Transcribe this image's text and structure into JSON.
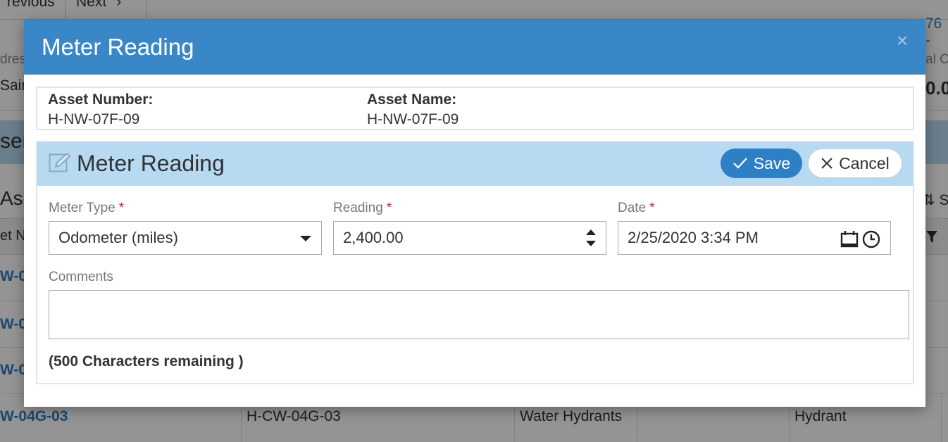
{
  "background": {
    "pager_prev": "revious",
    "pager_next": "Next",
    "record_count": "76 -",
    "address_label": "dres",
    "address_value": "Sain",
    "total_label": "al Co",
    "total_value": "0.0",
    "band_text": "ser",
    "grid_title": "As",
    "sort_label": "So",
    "column_header": "et N",
    "rows": [
      {
        "asset_number": "W-0",
        "asset_name": "",
        "type": "",
        "class": ""
      },
      {
        "asset_number": "W-0",
        "asset_name": "",
        "type": "",
        "class": ""
      },
      {
        "asset_number": "W-0",
        "asset_name": "",
        "type": "",
        "class": ""
      },
      {
        "asset_number": "W-04G-03",
        "asset_name": "H-CW-04G-03",
        "type": "Water Hydrants",
        "class": "Hydrant"
      }
    ]
  },
  "modal": {
    "title": "Meter Reading",
    "close_symbol": "×",
    "asset": {
      "number_label": "Asset Number:",
      "number_value": "H-NW-07F-09",
      "name_label": "Asset Name:",
      "name_value": "H-NW-07F-09"
    },
    "form": {
      "title": "Meter Reading",
      "save_label": "Save",
      "cancel_label": "Cancel",
      "meter_type": {
        "label": "Meter Type",
        "required": "*",
        "value": "Odometer (miles)"
      },
      "reading": {
        "label": "Reading",
        "required": "*",
        "value": "2,400.00"
      },
      "date": {
        "label": "Date",
        "required": "*",
        "value": "2/25/2020 3:34 PM"
      },
      "comments": {
        "label": "Comments",
        "value": ""
      },
      "chars_remaining": "(500 Characters remaining )"
    }
  },
  "colors": {
    "header_blue": "#3a87c8",
    "panel_blue": "#b7d9f2",
    "save_blue": "#2f7fc4",
    "required_red": "#d9262c",
    "link_blue": "#2d7cc0"
  },
  "icons": [
    "close-icon",
    "edit-icon",
    "checkmark-icon",
    "x-icon",
    "dropdown-arrow-icon",
    "spinner-icon",
    "calendar-icon",
    "clock-icon",
    "filter-icon",
    "chevron-right-icon",
    "sort-icon"
  ]
}
